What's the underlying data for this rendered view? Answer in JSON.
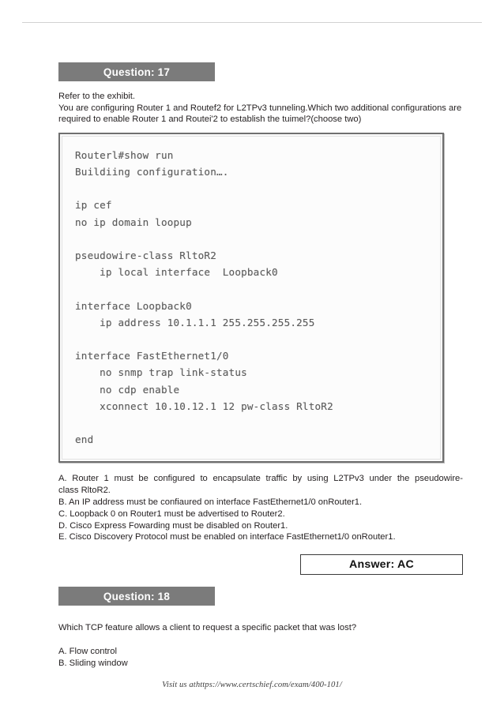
{
  "document": {
    "page_background": "#ffffff",
    "header_bar_color": "#7b7b7b",
    "text_color": "#231f20"
  },
  "question17": {
    "header_label": "Question: 17",
    "intro_line": "Refer to the exhibit.",
    "body_line1": "You are configuring Router 1 and Routef2 for L2TPv3 tunneling.Which two additional configurations are",
    "body_line2": "required to enable Router 1 and Routei'2 to establish the tuimel?(choose two)",
    "exhibit": {
      "code_lines": [
        "Routerl#show run",
        "Buildiing configuration….",
        "",
        "ip cef",
        "no ip domain loopup",
        "",
        "pseudowire-class RltoR2",
        "    ip local interface  Loopback0",
        "",
        "interface Loopback0",
        "    ip address 10.1.1.1 255.255.255.255",
        "",
        "interface FastEthernet1/0",
        "    no snmp trap link-status",
        "    no cdp enable",
        "    xconnect 10.10.12.1 12 pw-class RltoR2",
        "",
        "end"
      ]
    },
    "options": [
      "A.  Router  1  must  be  configured  to  encapsulate  traffic  by  using  L2TPv3  under  the  pseudowire-class RltoR2.",
      "B. An IP address must be confiaured on interface FastEthernet1/0 onRouter1.",
      "C. Loopback 0 on Router1 must be advertised to Router2.",
      "D. Cisco Express Fowarding must be disabled on Router1.",
      "E. Cisco Discovery Protocol must be enabled on interface FastEthernet1/0 onRouter1."
    ],
    "answer_label": "Answer: AC"
  },
  "question18": {
    "header_label": "Question: 18",
    "body_line1": "Which TCP feature allows a client to request a specific packet that was lost?",
    "options": [
      "A. Flow control",
      "B. Sliding window"
    ]
  },
  "footer": {
    "text": "Visit us athttps://www.certschief.com/exam/400-101/"
  }
}
